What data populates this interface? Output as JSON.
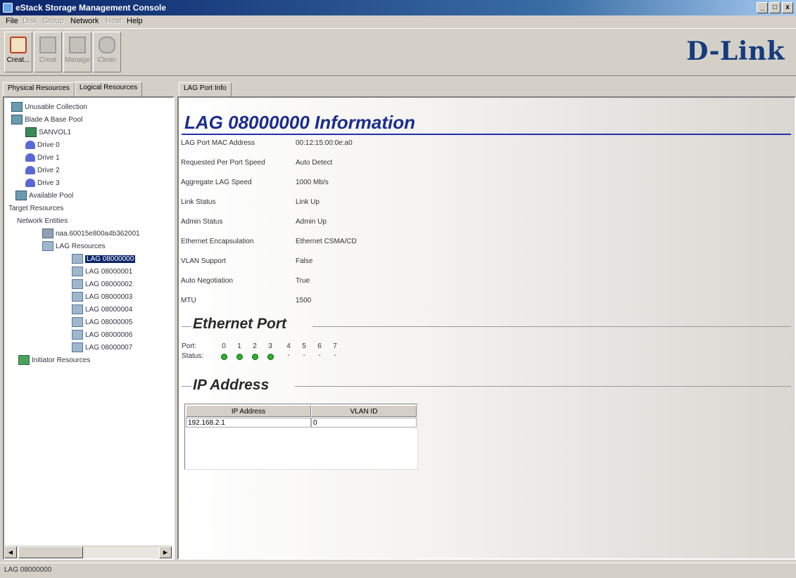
{
  "window": {
    "title": "eStack Storage Management Console",
    "minimize": "_",
    "maximize": "□",
    "close": "x"
  },
  "menu": [
    {
      "label": "File",
      "enabled": true
    },
    {
      "label": "Disk",
      "enabled": false
    },
    {
      "label": "Group",
      "enabled": false
    },
    {
      "label": "Network",
      "enabled": true
    },
    {
      "label": "Host",
      "enabled": false
    },
    {
      "label": "Help",
      "enabled": true
    }
  ],
  "toolbar": {
    "buttons": [
      {
        "label": "Creat...",
        "icon": "create-icon",
        "enabled": true
      },
      {
        "label": "Creat",
        "icon": "document-icon",
        "enabled": false
      },
      {
        "label": "Manage",
        "icon": "document-icon",
        "enabled": false
      },
      {
        "label": "Clean",
        "icon": "gear-icon",
        "enabled": false
      }
    ]
  },
  "logo": "D-Link",
  "left_tabs": [
    "Physical Resources",
    "Logical Resources"
  ],
  "tree": [
    {
      "label": "Unusable Collection",
      "icon": "pool"
    },
    {
      "label": "Blade A Base Pool",
      "icon": "pool"
    },
    {
      "label": "SANVOL1",
      "icon": "vol"
    },
    {
      "label": "Drive 0",
      "icon": "drive"
    },
    {
      "label": "Drive 1",
      "icon": "drive"
    },
    {
      "label": "Drive 2",
      "icon": "drive"
    },
    {
      "label": "Drive 3",
      "icon": "drive"
    },
    {
      "label": "Available Pool",
      "icon": "pool"
    },
    {
      "label": "Target Resources",
      "icon": ""
    },
    {
      "label": "Network Entities",
      "icon": ""
    },
    {
      "label": "naa.60015e800a4b362001",
      "icon": "net"
    },
    {
      "label": "LAG Resources",
      "icon": "lag"
    },
    {
      "label": "LAG 08000000",
      "icon": "lag"
    },
    {
      "label": "LAG 08000001",
      "icon": "lag"
    },
    {
      "label": "LAG 08000002",
      "icon": "lag"
    },
    {
      "label": "LAG 08000003",
      "icon": "lag"
    },
    {
      "label": "LAG 08000004",
      "icon": "lag"
    },
    {
      "label": "LAG 08000005",
      "icon": "lag"
    },
    {
      "label": "LAG 08000006",
      "icon": "lag"
    },
    {
      "label": "LAG 08000007",
      "icon": "lag"
    },
    {
      "label": "Initiator Resources",
      "icon": "init"
    }
  ],
  "right_tab": "LAG Port Info",
  "info": {
    "title": "LAG 08000000 Information",
    "fields": [
      {
        "label": "LAG Port MAC Address",
        "value": "00:12:15:00:0e:a0"
      },
      {
        "label": "Requested Per Port Speed",
        "value": "Auto Detect"
      },
      {
        "label": "Aggregate LAG Speed",
        "value": "1000 Mb/s"
      },
      {
        "label": "Link Status",
        "value": "Link Up"
      },
      {
        "label": "Admin Status",
        "value": "Admin Up"
      },
      {
        "label": "Ethernet Encapsulation",
        "value": "Ethernet CSMA/CD"
      },
      {
        "label": "VLAN Support",
        "value": "False"
      },
      {
        "label": "Auto Negotiation",
        "value": "True"
      },
      {
        "label": "MTU",
        "value": "1500"
      }
    ]
  },
  "ethernet": {
    "title": "Ethernet Port",
    "port_label": "Port:",
    "status_label": "Status:",
    "ports": [
      {
        "num": "0",
        "status": "up"
      },
      {
        "num": "1",
        "status": "up"
      },
      {
        "num": "2",
        "status": "up"
      },
      {
        "num": "3",
        "status": "up"
      },
      {
        "num": "4",
        "status": "-"
      },
      {
        "num": "5",
        "status": "-"
      },
      {
        "num": "6",
        "status": "-"
      },
      {
        "num": "7",
        "status": "-"
      }
    ],
    "up_color": "#2eb02e"
  },
  "ip": {
    "title": "IP Address",
    "columns": [
      "IP Address",
      "VLAN ID"
    ],
    "rows": [
      [
        "192.168.2.1",
        "0"
      ]
    ]
  },
  "status_bar": "LAG 08000000"
}
